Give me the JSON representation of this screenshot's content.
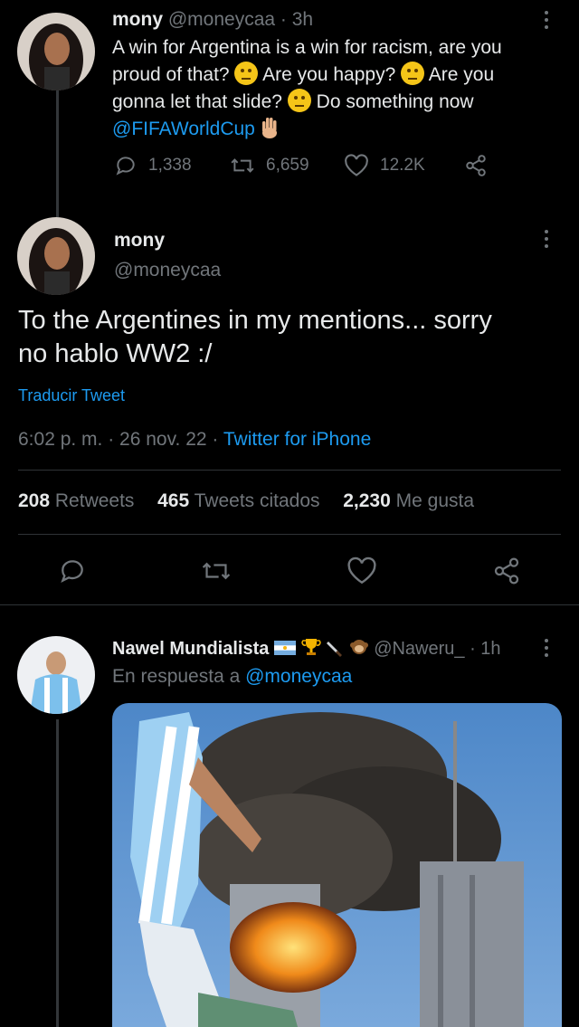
{
  "tweet1": {
    "name": "mony",
    "handle": "@moneycaa",
    "time": "· 3h",
    "text_line1": "A win for Argentina is a win for racism, are you",
    "text_line2a": "proud of that?",
    "text_line2b": "Are you happy?",
    "text_line2c": "Are you",
    "text_line3a": "gonna let that slide?",
    "text_line3b": "Do something now",
    "mention": "@FIFAWorldCup",
    "replies": "1,338",
    "retweets": "6,659",
    "likes": "12.2K"
  },
  "tweet2": {
    "name": "mony",
    "handle": "@moneycaa",
    "text_line1": "To the Argentines in my mentions... sorry",
    "text_line2": "no hablo WW2 :/",
    "translate": "Traducir Tweet",
    "timestamp": "6:02 p. m. · 26 nov. 22 · ",
    "source": "Twitter for iPhone",
    "stats": {
      "retweets_count": "208",
      "retweets_label": "Retweets",
      "quotes_count": "465",
      "quotes_label": "Tweets citados",
      "likes_count": "2,230",
      "likes_label": "Me gusta"
    }
  },
  "tweet3": {
    "name": "Nawel Mundialista",
    "handle": "@Naweru_",
    "time": "· 1h",
    "reply_prefix": "En respuesta a",
    "reply_to": "@moneycaa"
  },
  "colors": {
    "background": "#000000",
    "text": "#e7e9ea",
    "muted": "#71767b",
    "link": "#1d9bf0"
  }
}
